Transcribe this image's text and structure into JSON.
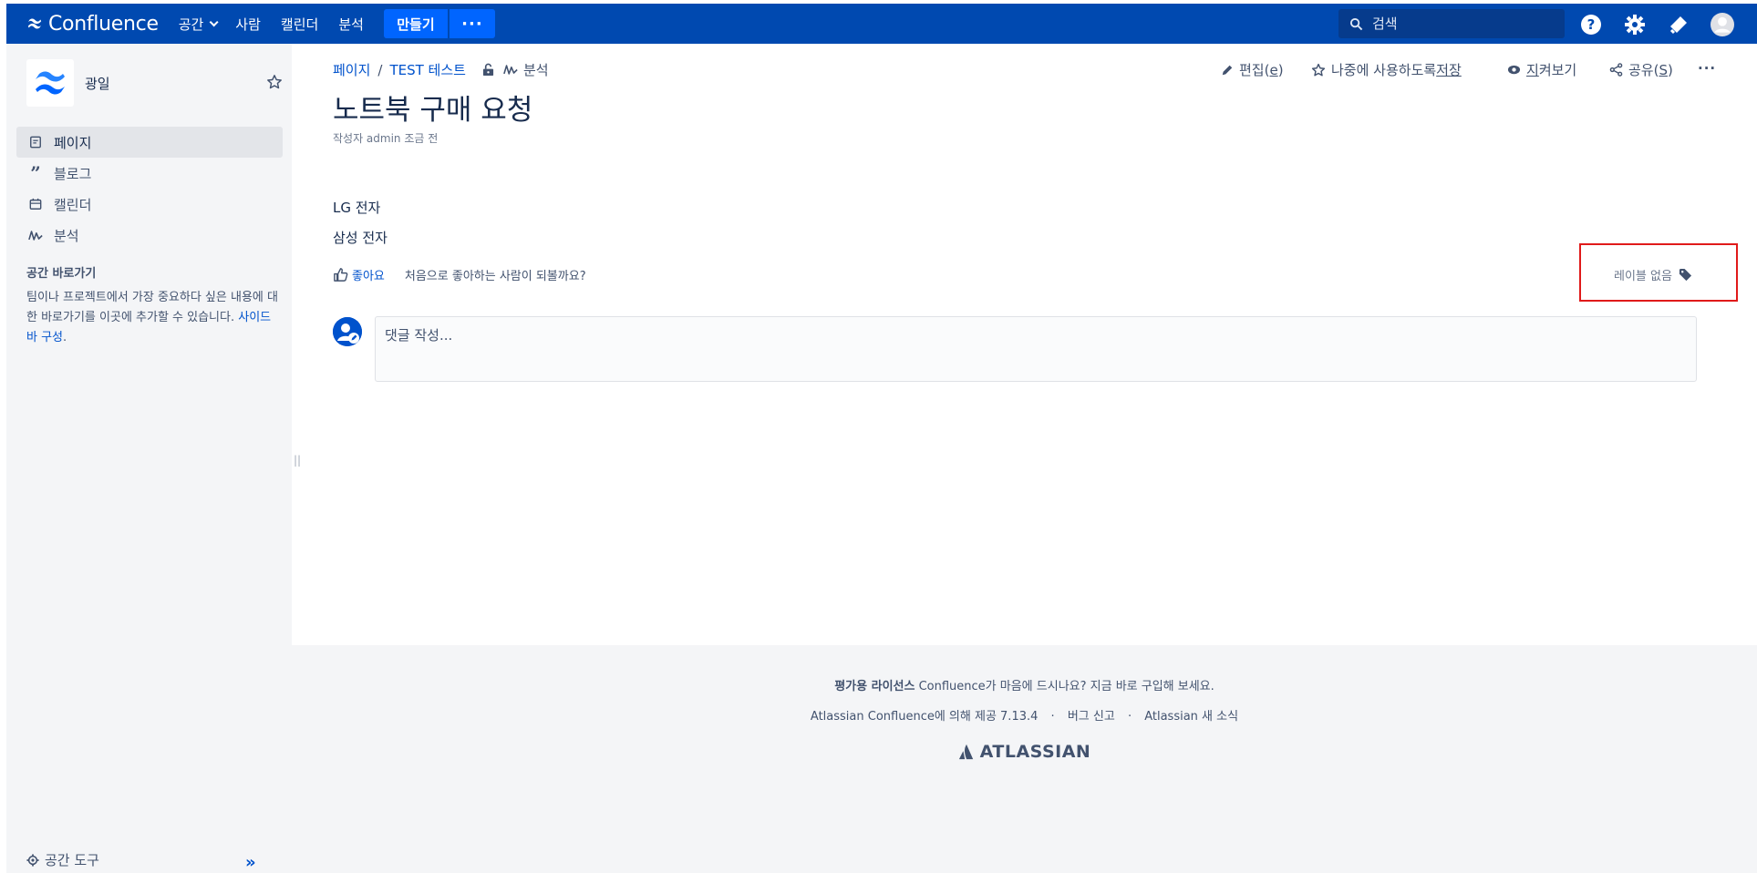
{
  "topnav": {
    "brand": "Confluence",
    "items": [
      "공간",
      "사람",
      "캘린더",
      "분석"
    ],
    "create_label": "만들기",
    "more_label": "···",
    "search_placeholder": "검색"
  },
  "sidebar": {
    "space_name": "광일",
    "items": [
      {
        "label": "페이지",
        "icon": "page-icon",
        "active": true
      },
      {
        "label": "블로그",
        "icon": "quote-icon",
        "active": false
      },
      {
        "label": "캘린더",
        "icon": "calendar-icon",
        "active": false
      },
      {
        "label": "분석",
        "icon": "analytics-icon",
        "active": false
      }
    ],
    "shortcuts_title": "공간 바로가기",
    "shortcuts_desc": "팀이나 프로젝트에서 가장 중요하다 싶은 내용에 대한 바로가기를 이곳에 추가할 수 있습니다. ",
    "shortcuts_link": "사이드 바 구성",
    "shortcuts_period": ".",
    "space_tools": "공간 도구",
    "collapse": "»"
  },
  "page": {
    "breadcrumb": [
      "페이지",
      "TEST 테스트"
    ],
    "breadcrumb_sep": "/",
    "analysis": "분석",
    "title": "노트북 구매 요청",
    "byline": "작성자 admin 조금 전",
    "body": [
      "LG 전자",
      "삼성 전자"
    ],
    "like": "좋아요",
    "like_hint": "처음으로 좋아하는 사람이 되볼까요?",
    "labels": "레이블 없음",
    "comment_placeholder": "댓글 작성..."
  },
  "actions": {
    "edit": "편집(",
    "edit_key": "e",
    "edit_end": ")",
    "save_pre": "나중에 사용하도록 ",
    "save_key": "저장",
    "watch_key": "지",
    "watch_rest": "켜보기",
    "share_pre": "공유(",
    "share_key": "S",
    "share_end": ")",
    "more": "···"
  },
  "footer": {
    "license_bold": "평가용 라이선스",
    "license_text": " Confluence가 마음에 드시나요? 지금 바로 구입해 보세요.",
    "powered": "Atlassian Confluence에 의해 제공 7.13.4",
    "bug": "버그 신고",
    "news": "Atlassian 새 소식",
    "dot": "·",
    "logo": "ATLASSIAN"
  },
  "colors": {
    "nav_bg": "#0049b0",
    "accent": "#0052cc",
    "create_btn": "#0065ff",
    "highlight_box": "#e01a1a"
  }
}
